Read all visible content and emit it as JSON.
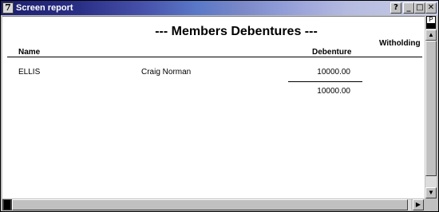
{
  "window": {
    "title": "Screen report",
    "icon_glyph": "7",
    "buttons": {
      "help": "?",
      "minimize": "_",
      "maximize": "□",
      "close": "✕"
    }
  },
  "report": {
    "title": "---  Members Debentures  ---",
    "columns": {
      "name": "Name",
      "debenture": "Debenture",
      "withholding": "Witholding"
    },
    "rows": [
      {
        "surname": "ELLIS",
        "given_names": "Craig Norman",
        "debenture": "10000.00"
      }
    ],
    "total_debenture": "10000.00"
  },
  "scrollbars": {
    "page_marker": "P",
    "up_arrow": "▲",
    "down_arrow": "▼",
    "right_arrow": "▶"
  },
  "colors": {
    "titlebar_start": "#1c1f6e",
    "titlebar_end": "#c8cce8",
    "chrome": "#c0c0c0"
  }
}
